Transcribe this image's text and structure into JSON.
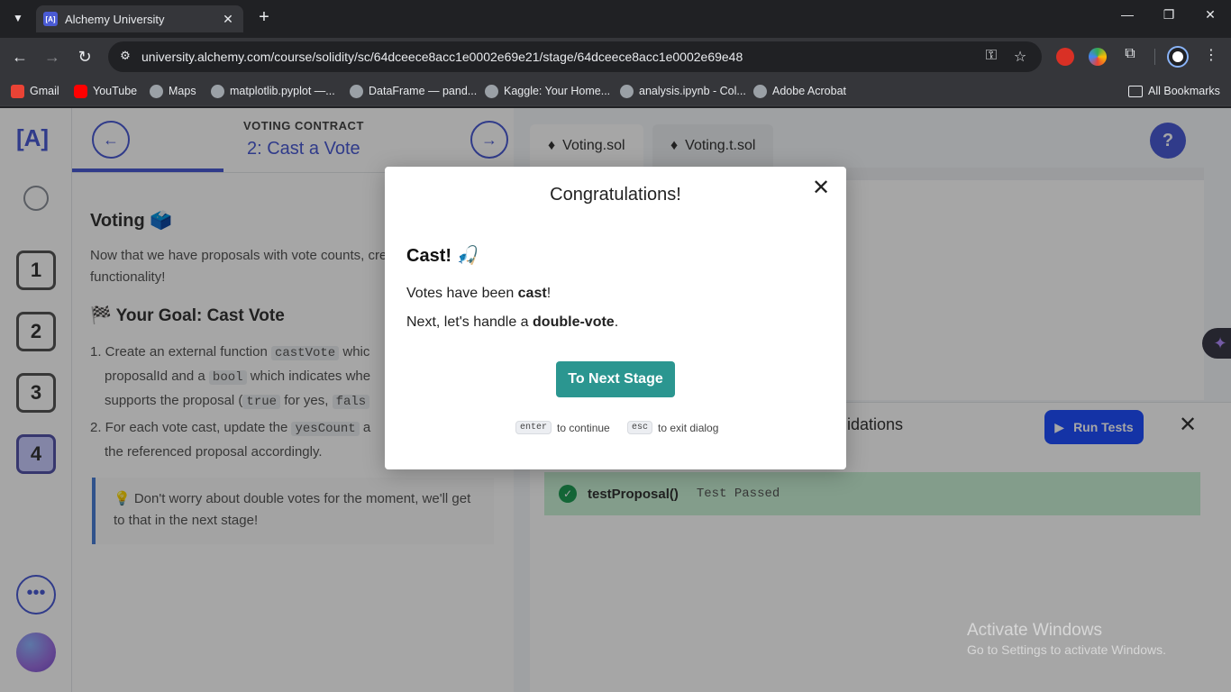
{
  "browser": {
    "tab_title": "Alchemy University",
    "url": "university.alchemy.com/course/solidity/sc/64dceece8acc1e0002e69e21/stage/64dceece8acc1e0002e69e48",
    "bookmarks": [
      {
        "label": "Gmail",
        "icon": "gmail-icon"
      },
      {
        "label": "YouTube",
        "icon": "youtube-icon"
      },
      {
        "label": "Maps",
        "icon": "globe-icon"
      },
      {
        "label": "matplotlib.pyplot —...",
        "icon": "globe-icon"
      },
      {
        "label": "DataFrame — pand...",
        "icon": "globe-icon"
      },
      {
        "label": "Kaggle: Your Home...",
        "icon": "globe-icon"
      },
      {
        "label": "analysis.ipynb - Col...",
        "icon": "globe-icon"
      },
      {
        "label": "Adobe Acrobat",
        "icon": "globe-icon"
      }
    ],
    "all_bookmarks": "All Bookmarks"
  },
  "sidebar": {
    "logo": "[A]",
    "stages": [
      "1",
      "2",
      "3",
      "4"
    ],
    "active_stage": "4"
  },
  "lesson_header": {
    "kicker": "VOTING CONTRACT",
    "title": "2: Cast a Vote"
  },
  "lesson": {
    "heading": "Voting 🗳️",
    "intro": "Now that we have proposals with vote counts, create voting functionality!",
    "goal_heading": "🏁 Your Goal: Cast Vote",
    "step1_a": "1. Create an external function ",
    "step1_code1": "castVote",
    "step1_b": " whic",
    "step1_c": "proposalId and a ",
    "step1_code2": "bool",
    "step1_d": " which indicates whe",
    "step1_e": "supports the proposal (",
    "step1_code3": "true",
    "step1_f": " for yes, ",
    "step1_code4": "fals",
    "step2_a": "2. For each vote cast, update the ",
    "step2_code": "yesCount",
    "step2_b": " a",
    "step2_c": "the referenced proposal accordingly.",
    "callout": "💡 Don't worry about double votes for the moment, we'll get to that in the next stage!"
  },
  "editor": {
    "tabs": [
      "Voting.sol",
      "Voting.t.sol"
    ],
    "help": "?"
  },
  "results": {
    "label": "idations",
    "run_tests": "Run Tests",
    "test_name": "testProposal()",
    "test_status": "Test Passed"
  },
  "modal": {
    "title": "Congratulations!",
    "heading": "Cast! 🎣",
    "line1_a": "Votes have been ",
    "line1_b": "cast",
    "line1_c": "!",
    "line2_a": "Next, let's handle a ",
    "line2_b": "double-vote",
    "line2_c": ".",
    "button": "To Next Stage",
    "hint_enter_key": "enter",
    "hint_enter_text": "to continue",
    "hint_esc_key": "esc",
    "hint_esc_text": "to exit dialog"
  },
  "watermark": {
    "line1": "Activate Windows",
    "line2": "Go to Settings to activate Windows."
  }
}
